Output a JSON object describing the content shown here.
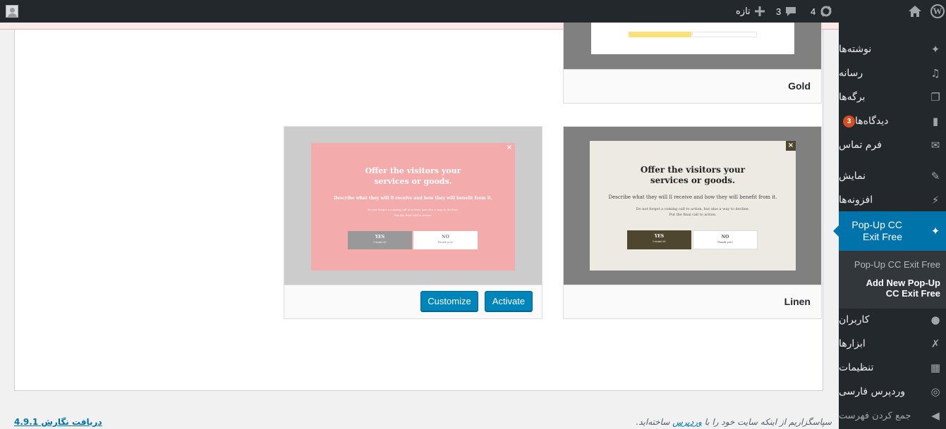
{
  "adminbar": {
    "updates_count": "4",
    "comments_count": "3",
    "new_label": "تازه"
  },
  "menu": {
    "items": [
      {
        "label": "نوشته‌ها",
        "icon": "pin-icon"
      },
      {
        "label": "رسانه",
        "icon": "media-icon"
      },
      {
        "label": "برگه‌ها",
        "icon": "pages-icon"
      },
      {
        "label": "دیدگاه‌ها",
        "icon": "comment-icon",
        "badge": "3"
      },
      {
        "label": "فرم تماس",
        "icon": "mail-icon"
      },
      {
        "label": "نمایش",
        "icon": "brush-icon"
      },
      {
        "label": "افزونه‌ها",
        "icon": "plugin-icon"
      },
      {
        "label": "Pop-Up CC Exit Free",
        "icon": "pin-icon"
      },
      {
        "label": "کاربران",
        "icon": "users-icon"
      },
      {
        "label": "ابزارها",
        "icon": "wrench-icon"
      },
      {
        "label": "تنظیمات",
        "icon": "settings-icon"
      },
      {
        "label": "وردپرس فارسی",
        "icon": "wordpress-icon"
      },
      {
        "label": "جمع کردن فهرست",
        "icon": "collapse-icon"
      }
    ],
    "submenu": [
      "Pop-Up CC Exit Free",
      "Add New Pop-Up CC Exit Free"
    ]
  },
  "themes": {
    "gold": {
      "name": "Gold"
    },
    "linen": {
      "name": "Linen",
      "popup_title": "Offer the visitors your services or goods.",
      "popup_desc": "Describe what they will ll receive and how they will benefit from it.",
      "popup_small_1": "Do not forget a coming call to action, but also a way to decline.",
      "popup_small_2": "Put the final call to action.",
      "yes_label": "YES",
      "yes_sub": "I want it!",
      "no_label": "NO",
      "no_sub": "Thank you!"
    },
    "pink": {
      "popup_title": "Offer the visitors your services or goods.",
      "popup_desc": "Describe what they will ll receive and how they will benefit from it.",
      "popup_small_1": "Do not forget a coming call to action, but also a way to decline.",
      "popup_small_2": "Put the final call to action.",
      "yes_label": "YES",
      "yes_sub": "I want it!",
      "no_label": "NO",
      "no_sub": "Thank you!",
      "customize_label": "Customize",
      "activate_label": "Activate"
    }
  },
  "footer": {
    "thanks_prefix": "سپاسگزاریم از اینکه سایت خود را با",
    "thanks_link": "وردپرس",
    "thanks_suffix": "ساخته‌اید.",
    "version_link": "دریافت نگارش 4.9.1"
  },
  "colors": {
    "admin_dark": "#23282d",
    "accent_blue": "#0073aa",
    "button_blue": "#0085ba",
    "badge_orange": "#d54e21",
    "pink_popup": "#f4abab",
    "linen_popup": "#edeae3",
    "linen_dark": "#4f4630"
  }
}
